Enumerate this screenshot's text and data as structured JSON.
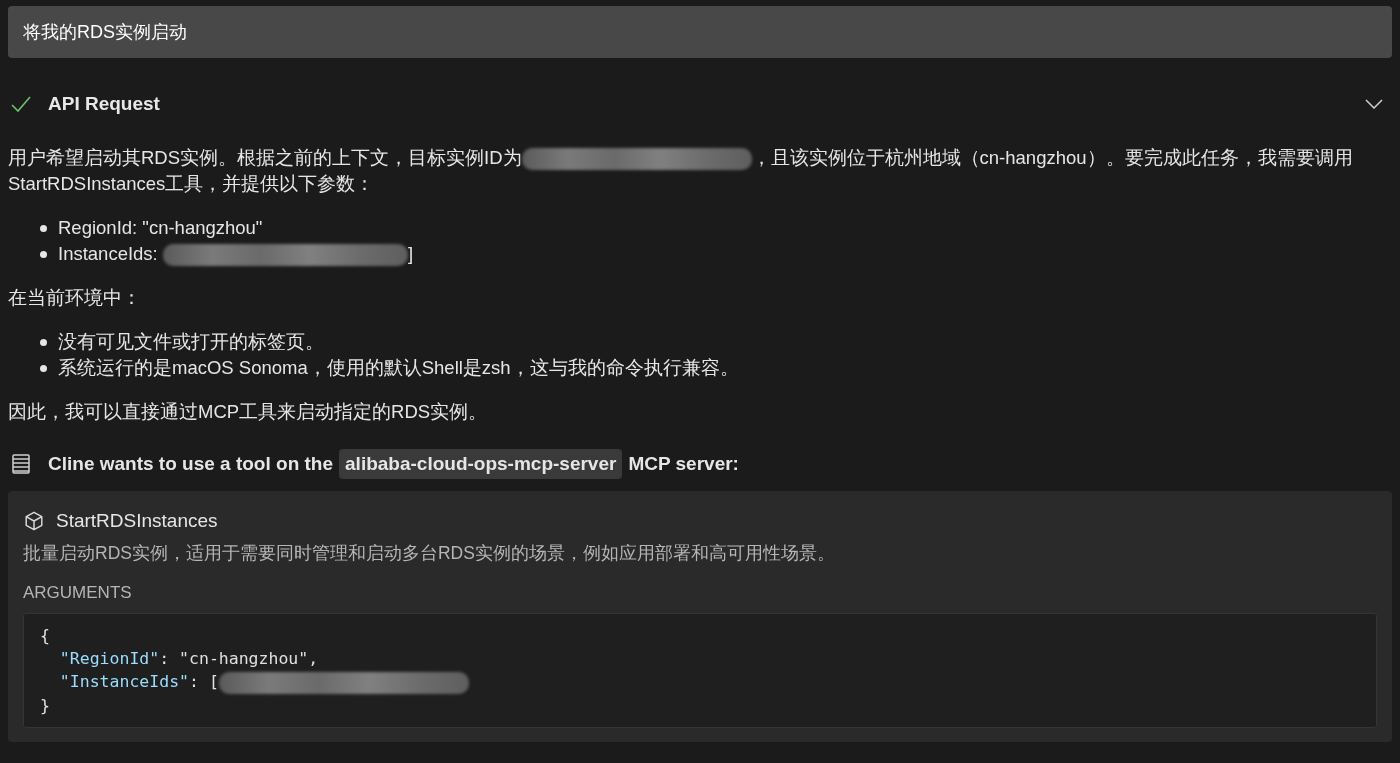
{
  "task": {
    "text": "将我的RDS实例启动"
  },
  "api_request": {
    "title": "API Request",
    "succeeded": true,
    "expanded": true
  },
  "reasoning": [
    {
      "kind": "paragraph",
      "segments": [
        {
          "kind": "text",
          "text": "用户希望启动其RDS实例。根据之前的上下文，目标实例ID为"
        },
        {
          "kind": "redacted"
        },
        {
          "kind": "text",
          "text": "，且该实例位于杭州地域（cn-hangzhou）。要完成此任务，我需要调用StartRDSInstances工具，并提供以下参数："
        }
      ]
    },
    {
      "kind": "list",
      "items": [
        {
          "segments": [
            {
              "kind": "text",
              "text": "RegionId: \"cn-hangzhou\""
            }
          ]
        },
        {
          "segments": [
            {
              "kind": "text",
              "text": "InstanceIds: "
            },
            {
              "kind": "redacted"
            },
            {
              "kind": "text",
              "text": "]"
            }
          ]
        }
      ]
    },
    {
      "kind": "paragraph",
      "segments": [
        {
          "kind": "text",
          "text": "在当前环境中："
        }
      ]
    },
    {
      "kind": "list",
      "items": [
        {
          "segments": [
            {
              "kind": "text",
              "text": "没有可见文件或打开的标签页。"
            }
          ]
        },
        {
          "segments": [
            {
              "kind": "text",
              "text": "系统运行的是macOS Sonoma，使用的默认Shell是zsh，这与我的命令执行兼容。"
            }
          ]
        }
      ]
    },
    {
      "kind": "paragraph",
      "segments": [
        {
          "kind": "text",
          "text": "因此，我可以直接通过MCP工具来启动指定的RDS实例。"
        }
      ]
    }
  ],
  "tool_request": {
    "before": "Cline wants to use a tool on the",
    "server": "alibaba-cloud-ops-mcp-server",
    "after": "MCP server:"
  },
  "tool_card": {
    "name": "StartRDSInstances",
    "description": "批量启动RDS实例，适用于需要同时管理和启动多台RDS实例的场景，例如应用部署和高可用性场景。",
    "arguments_label": "ARGUMENTS",
    "code_lines": [
      {
        "segments": [
          {
            "kind": "punct",
            "text": "{"
          }
        ]
      },
      {
        "segments": [
          {
            "kind": "key",
            "text": "  \"RegionId\""
          },
          {
            "kind": "punct",
            "text": ": \"cn-hangzhou\","
          }
        ]
      },
      {
        "segments": [
          {
            "kind": "key",
            "text": "  \"InstanceIds\""
          },
          {
            "kind": "punct",
            "text": ": ["
          },
          {
            "kind": "redacted"
          }
        ]
      },
      {
        "segments": [
          {
            "kind": "punct",
            "text": "}"
          }
        ]
      }
    ]
  }
}
